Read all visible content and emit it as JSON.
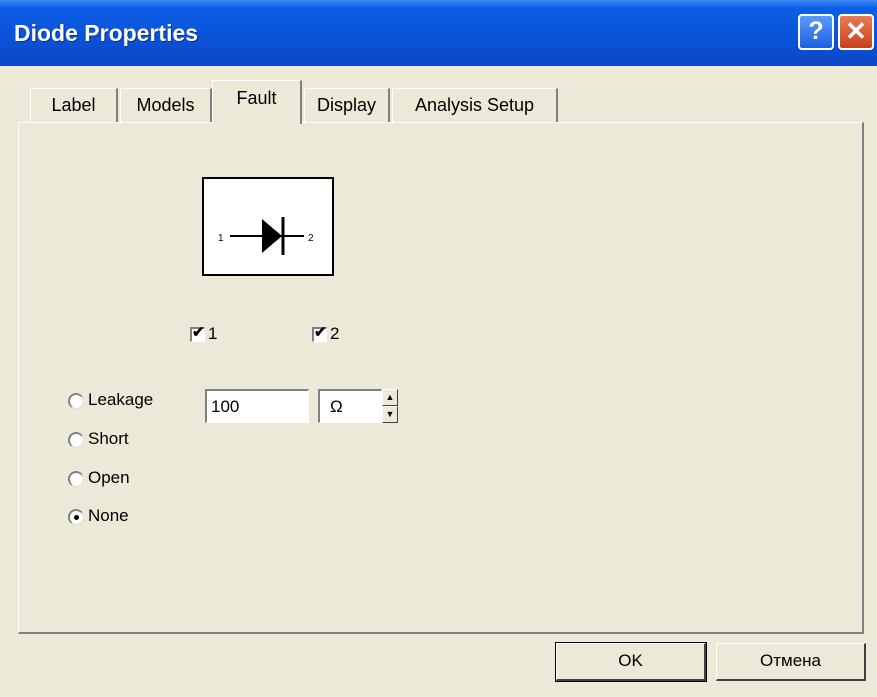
{
  "window": {
    "title": "Diode Properties",
    "help_label": "?",
    "close_label": "✕"
  },
  "tabs": [
    {
      "label": "Label"
    },
    {
      "label": "Models"
    },
    {
      "label": "Fault"
    },
    {
      "label": "Display"
    },
    {
      "label": "Analysis Setup"
    }
  ],
  "active_tab": "Fault",
  "diode": {
    "pin1": "1",
    "pin2": "2"
  },
  "pins": [
    {
      "label": "1",
      "checked": true
    },
    {
      "label": "2",
      "checked": true
    }
  ],
  "faults": [
    {
      "label": "Leakage",
      "selected": false
    },
    {
      "label": "Short",
      "selected": false
    },
    {
      "label": "Open",
      "selected": false
    },
    {
      "label": "None",
      "selected": true
    }
  ],
  "leakage": {
    "value": "100",
    "unit": "Ω"
  },
  "buttons": {
    "ok": "OK",
    "cancel": "Отмена"
  }
}
